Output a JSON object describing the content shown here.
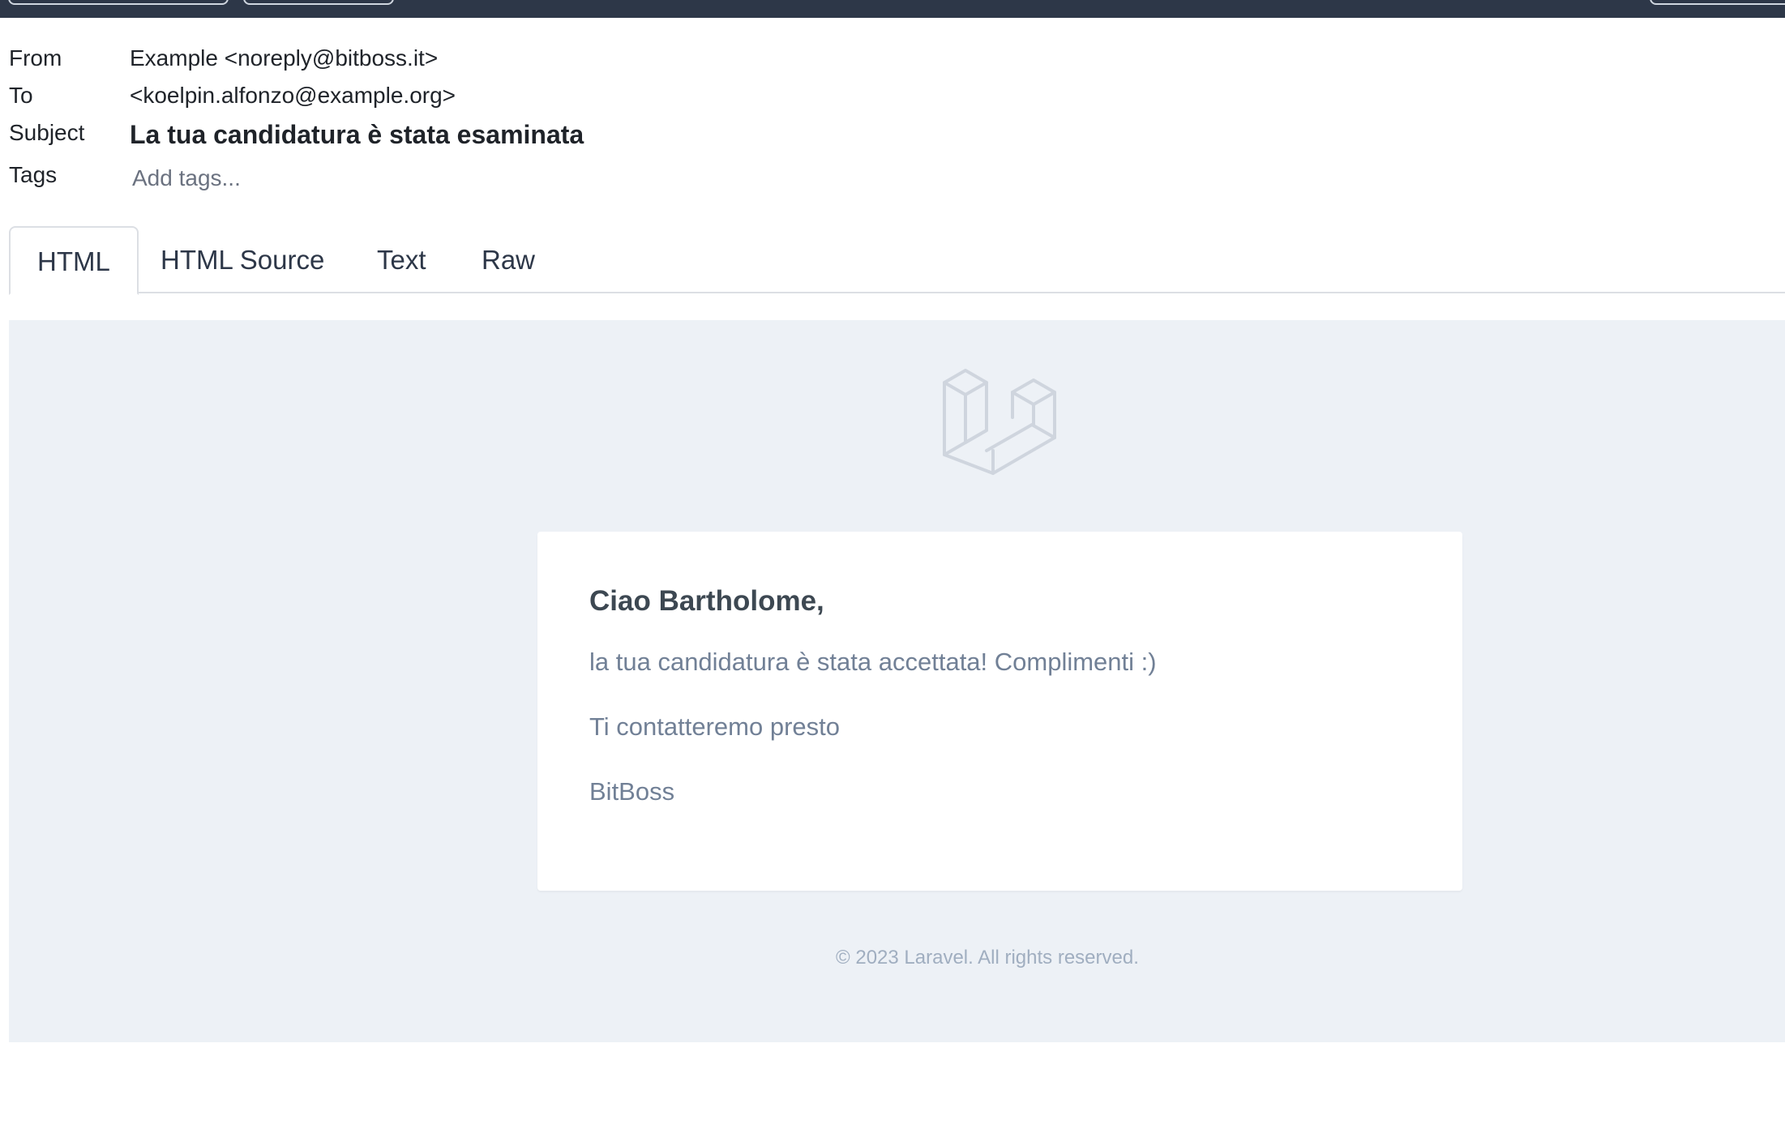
{
  "header": {
    "from_label": "From",
    "from_value": "Example <noreply@bitboss.it>",
    "to_label": "To",
    "to_value": "<koelpin.alfonzo@example.org>",
    "subject_label": "Subject",
    "subject_value": "La tua candidatura è stata esaminata",
    "tags_label": "Tags",
    "tags_placeholder": "Add tags..."
  },
  "tabs": [
    {
      "label": "HTML",
      "active": true
    },
    {
      "label": "HTML Source",
      "active": false
    },
    {
      "label": "Text",
      "active": false
    },
    {
      "label": "Raw",
      "active": false
    }
  ],
  "email": {
    "logo_icon": "laravel-logo-icon",
    "greeting": "Ciao Bartholome,",
    "paragraphs": [
      "la tua candidatura è stata accettata! Complimenti :)",
      "Ti contatteremo presto",
      "BitBoss"
    ],
    "footer": "© 2023 Laravel. All rights reserved."
  },
  "colors": {
    "topbar": "#2d3748",
    "preview_bg": "#edf1f6",
    "muted_text": "#718096",
    "heading_text": "#3d4852"
  }
}
